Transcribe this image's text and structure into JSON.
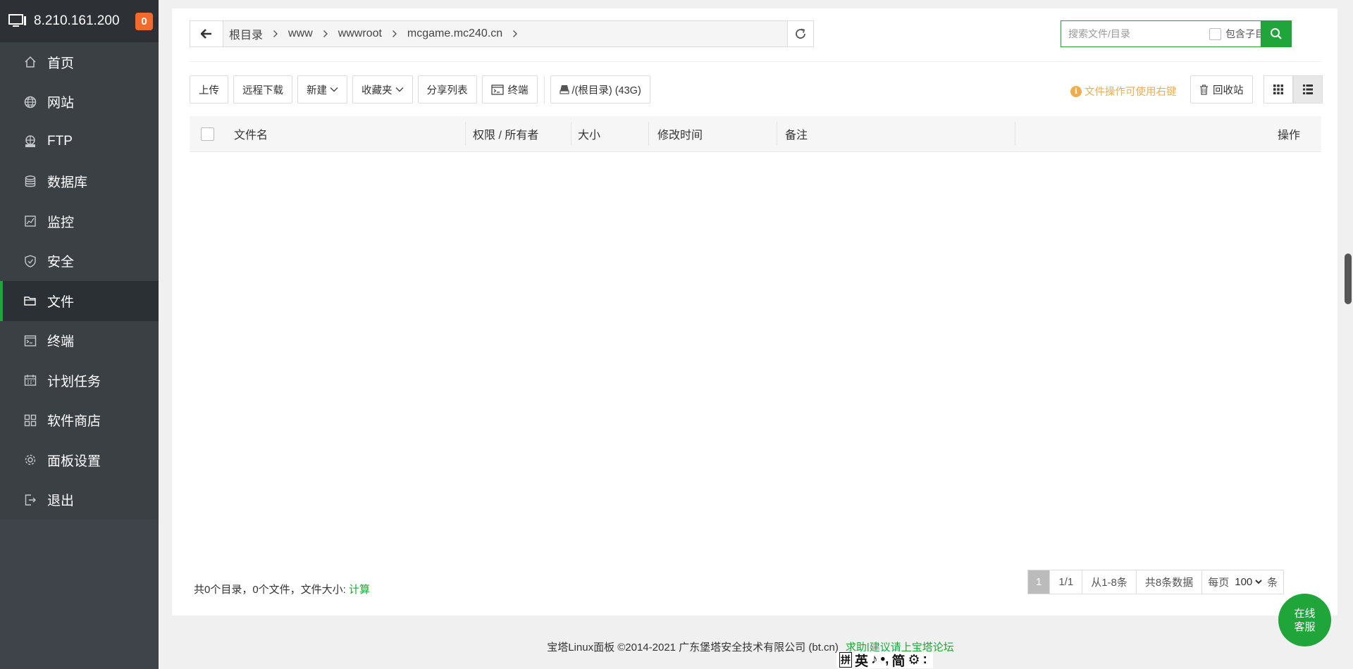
{
  "sidebar": {
    "ip": "8.210.161.200",
    "badge": "0",
    "items": [
      {
        "label": "首页",
        "icon": "home-icon"
      },
      {
        "label": "网站",
        "icon": "globe-icon"
      },
      {
        "label": "FTP",
        "icon": "ftp-icon"
      },
      {
        "label": "数据库",
        "icon": "database-icon"
      },
      {
        "label": "监控",
        "icon": "monitor-icon"
      },
      {
        "label": "安全",
        "icon": "shield-icon"
      },
      {
        "label": "文件",
        "icon": "folder-icon",
        "active": true
      },
      {
        "label": "终端",
        "icon": "terminal-icon"
      },
      {
        "label": "计划任务",
        "icon": "calendar-icon"
      },
      {
        "label": "软件商店",
        "icon": "apps-grid-icon"
      },
      {
        "label": "面板设置",
        "icon": "gear-icon"
      },
      {
        "label": "退出",
        "icon": "logout-icon"
      }
    ]
  },
  "path": {
    "crumbs": [
      "根目录",
      "www",
      "wwwroot",
      "mcgame.mc240.cn"
    ]
  },
  "search": {
    "placeholder": "搜索文件/目录",
    "include_sub": "包含子目录"
  },
  "toolbar": {
    "upload": "上传",
    "remote_download": "远程下载",
    "new": "新建",
    "favorites": "收藏夹",
    "share_list": "分享列表",
    "terminal": "终端",
    "disk": "/(根目录) (43G)"
  },
  "tip": "文件操作可使用右键",
  "recycle": "回收站",
  "table": {
    "headers": [
      "文件名",
      "权限 / 所有者",
      "大小",
      "修改时间",
      "备注",
      "操作"
    ]
  },
  "summary": {
    "text": "共0个目录，0个文件，文件大小: ",
    "calc": "计算"
  },
  "pager": {
    "current": "1",
    "pages": "1/1",
    "range": "从1-8条",
    "total": "共8条数据",
    "per_page_label": "每页",
    "per_page": "100",
    "unit": "条"
  },
  "footer": {
    "copyright": "宝塔Linux面板 ©2014-2021 广东堡塔安全技术有限公司 (bt.cn)",
    "help": "求助|建议请上宝塔论坛"
  },
  "help_button": {
    "line1": "在线",
    "line2": "客服"
  },
  "ime": [
    "拼",
    "英",
    "♪",
    "•,",
    "简",
    "⚙",
    ":"
  ],
  "colors": {
    "accent": "#20a53a",
    "sidebar": "#3e4449",
    "badge": "#f36b2c",
    "warn": "#f0ad4e"
  }
}
